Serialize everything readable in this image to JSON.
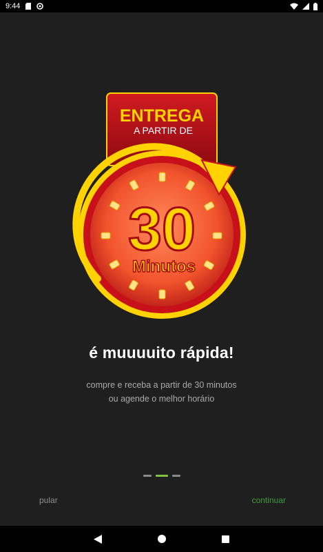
{
  "status_bar": {
    "time": "9:44",
    "icons": [
      "sd-card-icon",
      "sync-icon",
      "wifi-icon",
      "signal-icon",
      "battery-icon"
    ]
  },
  "hero": {
    "badge_top": "ENTREGA",
    "badge_sub": "A PARTIR DE",
    "number": "30",
    "unit": "Minutos",
    "colors": {
      "red": "#c8101a",
      "yellow": "#ffd200",
      "orange": "#f2542d"
    }
  },
  "headline": "é muuuuito rápida!",
  "subtitle": {
    "line1": "compre e receba a partir de 30 minutos",
    "line2": "ou agende o melhor horário"
  },
  "pager": {
    "count": 3,
    "active_index": 1
  },
  "actions": {
    "skip": "pular",
    "next": "continuar"
  },
  "navigation": {
    "buttons": [
      "back-icon",
      "home-icon",
      "recents-icon"
    ]
  }
}
